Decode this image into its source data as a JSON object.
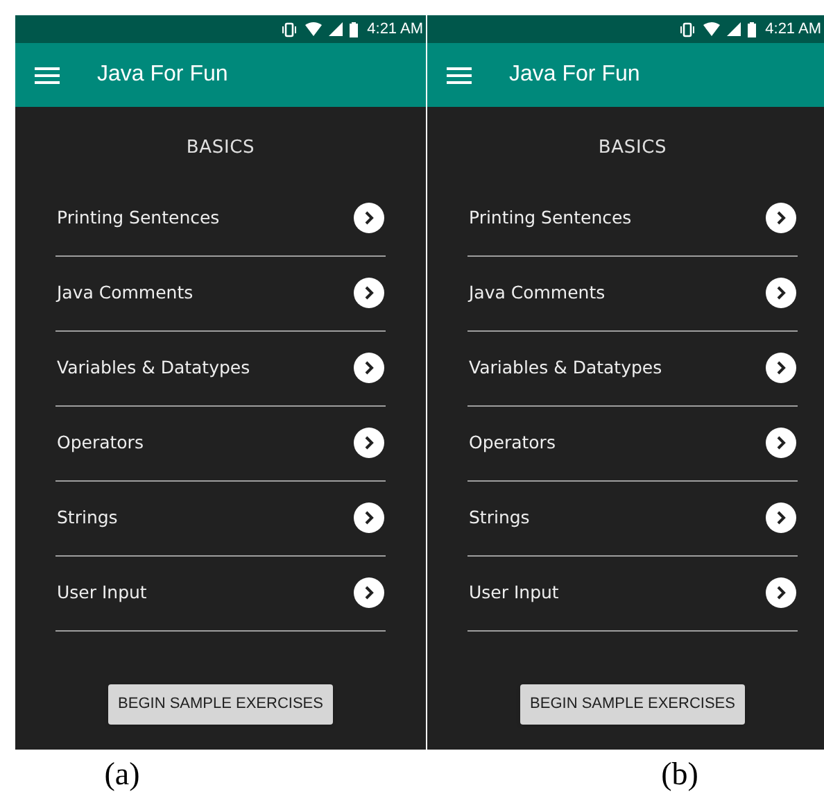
{
  "screens": [
    {
      "caption": "(a)",
      "status_time": "4:21 AM",
      "title": "Java For Fun",
      "section": "BASICS",
      "lessons": [
        "Printing Sentences",
        "Java Comments",
        "Variables & Datatypes",
        "Operators",
        "Strings",
        "User Input"
      ],
      "button": "BEGIN SAMPLE EXERCISES"
    },
    {
      "caption": "(b)",
      "status_time": "4:21 AM",
      "title": "Java For Fun",
      "section": "BASICS",
      "lessons": [
        "Printing Sentences",
        "Java Comments",
        "Variables & Datatypes",
        "Operators",
        "Strings",
        "User Input"
      ],
      "button": "BEGIN SAMPLE EXERCISES"
    }
  ]
}
